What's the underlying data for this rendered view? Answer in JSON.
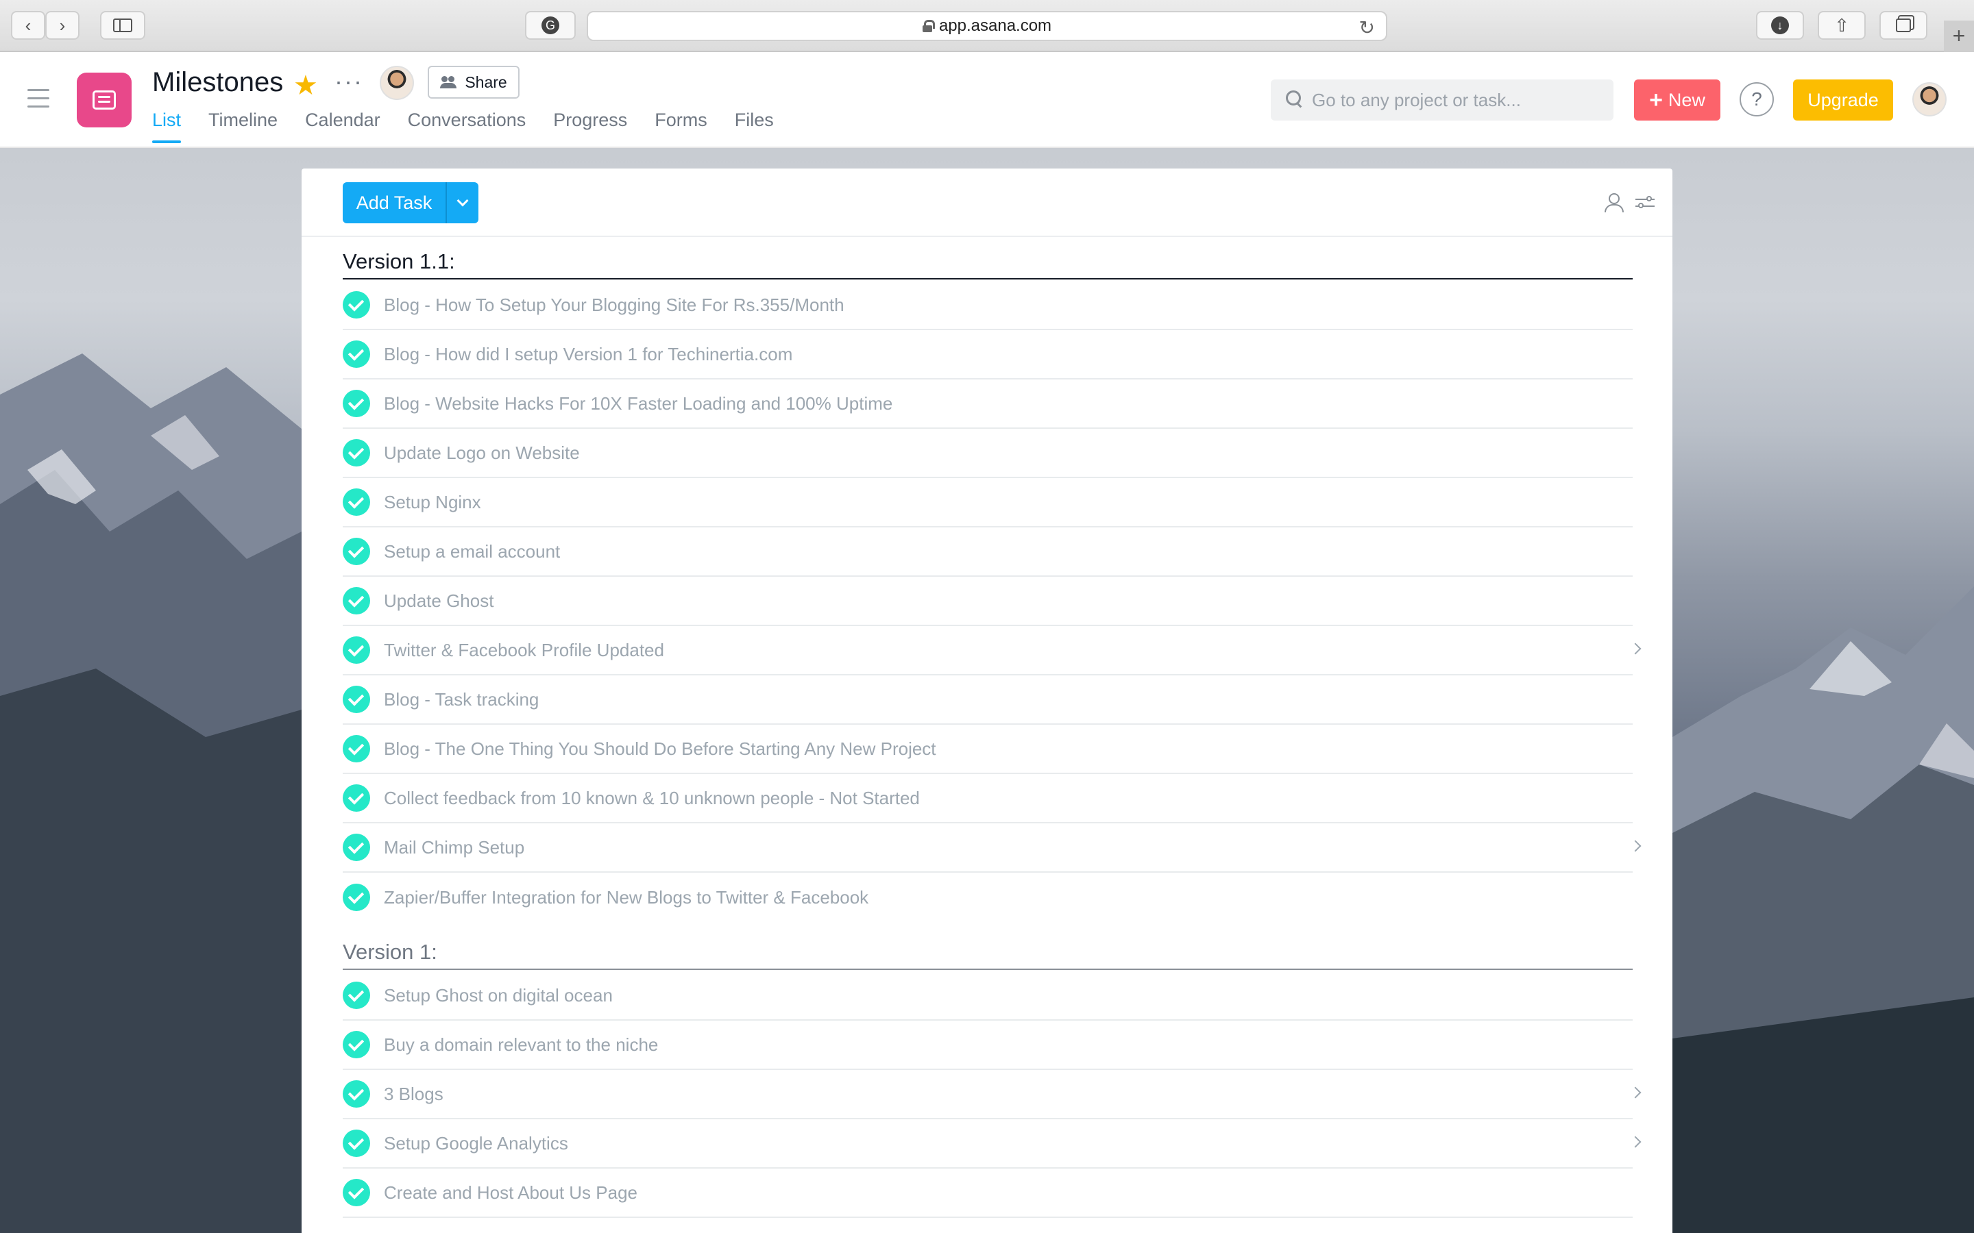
{
  "browser": {
    "url": "app.asana.com"
  },
  "header": {
    "project_title": "Milestones",
    "share_label": "Share",
    "tabs": [
      {
        "label": "List",
        "active": true
      },
      {
        "label": "Timeline",
        "active": false
      },
      {
        "label": "Calendar",
        "active": false
      },
      {
        "label": "Conversations",
        "active": false
      },
      {
        "label": "Progress",
        "active": false
      },
      {
        "label": "Forms",
        "active": false
      },
      {
        "label": "Files",
        "active": false
      }
    ],
    "search_placeholder": "Go to any project or task...",
    "new_label": "New",
    "help_label": "?",
    "upgrade_label": "Upgrade"
  },
  "toolbar": {
    "add_task_label": "Add Task"
  },
  "sections": [
    {
      "title": "Version 1.1:",
      "tasks": [
        {
          "label": "Blog - How To Setup Your Blogging Site For Rs.355/Month",
          "has_subtasks": false
        },
        {
          "label": "Blog - How did I setup Version 1 for Techinertia.com",
          "has_subtasks": false
        },
        {
          "label": "Blog - Website Hacks For 10X Faster Loading and 100% Uptime",
          "has_subtasks": false
        },
        {
          "label": "Update Logo on Website",
          "has_subtasks": false
        },
        {
          "label": "Setup Nginx",
          "has_subtasks": false
        },
        {
          "label": "Setup a email account",
          "has_subtasks": false
        },
        {
          "label": "Update Ghost",
          "has_subtasks": false
        },
        {
          "label": "Twitter & Facebook Profile Updated",
          "has_subtasks": true
        },
        {
          "label": "Blog - Task tracking",
          "has_subtasks": false
        },
        {
          "label": "Blog - The One Thing You Should Do Before Starting Any New Project",
          "has_subtasks": false
        },
        {
          "label": "Collect feedback from 10 known & 10 unknown people - Not Started",
          "has_subtasks": false
        },
        {
          "label": "Mail Chimp Setup",
          "has_subtasks": true
        },
        {
          "label": "Zapier/Buffer Integration for New Blogs to Twitter & Facebook",
          "has_subtasks": false
        }
      ]
    },
    {
      "title": "Version 1:",
      "tasks": [
        {
          "label": "Setup Ghost on digital ocean",
          "has_subtasks": false
        },
        {
          "label": "Buy a domain relevant to the niche",
          "has_subtasks": false
        },
        {
          "label": "3 Blogs",
          "has_subtasks": true
        },
        {
          "label": "Setup Google Analytics",
          "has_subtasks": true
        },
        {
          "label": "Create and Host About Us Page",
          "has_subtasks": false
        }
      ]
    }
  ],
  "colors": {
    "accent": "#14aaf5",
    "project_icon": "#e8488a",
    "new_button": "#fc636b",
    "upgrade_button": "#fcbd01",
    "complete_check": "#25e8c8",
    "favorite_star": "#f8b800"
  },
  "icons": [
    "back-icon",
    "forward-icon",
    "sidebar-toggle-icon",
    "grammarly-icon",
    "lock-icon",
    "reload-icon",
    "download-icon",
    "share-sheet-icon",
    "tabs-icon",
    "hamburger-icon",
    "project-list-icon",
    "star-icon",
    "more-icon",
    "people-icon",
    "search-icon",
    "plus-icon",
    "help-icon",
    "person-icon",
    "sliders-icon",
    "check-icon",
    "chevron-right-icon"
  ]
}
